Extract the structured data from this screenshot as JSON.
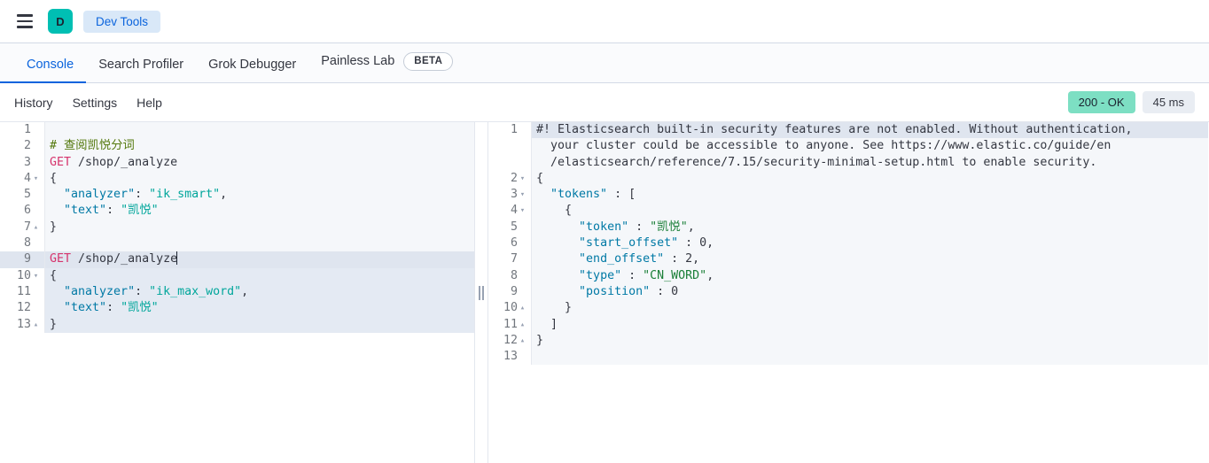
{
  "chrome": {
    "menu_icon": "hamburger-menu-icon",
    "space_avatar_letter": "D",
    "space_avatar_color": "#00BFB3",
    "breadcrumb_label": "Dev Tools"
  },
  "tabs": [
    {
      "label": "Console",
      "active": true
    },
    {
      "label": "Search Profiler",
      "active": false
    },
    {
      "label": "Grok Debugger",
      "active": false
    },
    {
      "label": "Painless Lab",
      "active": false,
      "badge": "BETA"
    }
  ],
  "console_toolbar": {
    "links": [
      "History",
      "Settings",
      "Help"
    ],
    "status_text": "200 - OK",
    "status_color": "#7DDFC3",
    "time_text": "45 ms",
    "time_color": "#E9EDF3"
  },
  "request_editor": {
    "play_icon": "play-triangle-icon",
    "wrench_icon": "wrench-icon",
    "lines": [
      {
        "n": "1",
        "fold": "",
        "tokens": []
      },
      {
        "n": "2",
        "fold": "",
        "tokens": [
          {
            "t": "# 查阅凯悦分词",
            "c": "c-comment"
          }
        ]
      },
      {
        "n": "3",
        "fold": "",
        "tokens": [
          {
            "t": "GET",
            "c": "c-method"
          },
          {
            "t": " /shop/_analyze",
            "c": "c-url"
          }
        ]
      },
      {
        "n": "4",
        "fold": "▾",
        "tokens": [
          {
            "t": "{",
            "c": "c-punc"
          }
        ]
      },
      {
        "n": "5",
        "fold": "",
        "tokens": [
          {
            "t": "  ",
            "c": "c-plain"
          },
          {
            "t": "\"analyzer\"",
            "c": "c-key"
          },
          {
            "t": ": ",
            "c": "c-punc"
          },
          {
            "t": "\"ik_smart\"",
            "c": "c-string"
          },
          {
            "t": ",",
            "c": "c-punc"
          }
        ]
      },
      {
        "n": "6",
        "fold": "",
        "tokens": [
          {
            "t": "  ",
            "c": "c-plain"
          },
          {
            "t": "\"text\"",
            "c": "c-key"
          },
          {
            "t": ": ",
            "c": "c-punc"
          },
          {
            "t": "\"凯悦\"",
            "c": "c-string"
          }
        ]
      },
      {
        "n": "7",
        "fold": "▴",
        "tokens": [
          {
            "t": "}",
            "c": "c-punc"
          }
        ]
      },
      {
        "n": "8",
        "fold": "",
        "tokens": []
      },
      {
        "n": "9",
        "fold": "",
        "active": true,
        "caret": true,
        "tokens": [
          {
            "t": "GET",
            "c": "c-method"
          },
          {
            "t": " /shop/_analyze",
            "c": "c-url"
          }
        ]
      },
      {
        "n": "10",
        "fold": "▾",
        "block": true,
        "tokens": [
          {
            "t": "{",
            "c": "c-punc"
          }
        ]
      },
      {
        "n": "11",
        "fold": "",
        "block": true,
        "tokens": [
          {
            "t": "  ",
            "c": "c-plain"
          },
          {
            "t": "\"analyzer\"",
            "c": "c-key"
          },
          {
            "t": ": ",
            "c": "c-punc"
          },
          {
            "t": "\"ik_max_word\"",
            "c": "c-string"
          },
          {
            "t": ",",
            "c": "c-punc"
          }
        ]
      },
      {
        "n": "12",
        "fold": "",
        "block": true,
        "tokens": [
          {
            "t": "  ",
            "c": "c-plain"
          },
          {
            "t": "\"text\"",
            "c": "c-key"
          },
          {
            "t": ": ",
            "c": "c-punc"
          },
          {
            "t": "\"凯悦\"",
            "c": "c-string"
          }
        ]
      },
      {
        "n": "13",
        "fold": "▴",
        "block": true,
        "tokens": [
          {
            "t": "}",
            "c": "c-punc"
          }
        ]
      }
    ]
  },
  "response_editor": {
    "error_marker": "error-x-icon",
    "lines": [
      {
        "n": "1",
        "fold": "",
        "warn": true,
        "tokens": [
          {
            "t": "#! Elasticsearch built-in security features are not enabled. Without authentication,",
            "c": "c-plain"
          }
        ]
      },
      {
        "n": "",
        "fold": "",
        "tokens": [
          {
            "t": "  your cluster could be accessible to anyone. See https://www.elastic.co/guide/en",
            "c": "c-plain"
          }
        ]
      },
      {
        "n": "",
        "fold": "",
        "tokens": [
          {
            "t": "  /elasticsearch/reference/7.15/security-minimal-setup.html to enable security.",
            "c": "c-plain"
          }
        ]
      },
      {
        "n": "2",
        "fold": "▾",
        "tokens": [
          {
            "t": "{",
            "c": "c-punc"
          }
        ]
      },
      {
        "n": "3",
        "fold": "▾",
        "tokens": [
          {
            "t": "  ",
            "c": "c-plain"
          },
          {
            "t": "\"tokens\"",
            "c": "c-key"
          },
          {
            "t": " : [",
            "c": "c-punc"
          }
        ]
      },
      {
        "n": "4",
        "fold": "▾",
        "tokens": [
          {
            "t": "    {",
            "c": "c-punc"
          }
        ]
      },
      {
        "n": "5",
        "fold": "",
        "tokens": [
          {
            "t": "      ",
            "c": "c-plain"
          },
          {
            "t": "\"token\"",
            "c": "c-key"
          },
          {
            "t": " : ",
            "c": "c-punc"
          },
          {
            "t": "\"凯悦\"",
            "c": "c-strjson"
          },
          {
            "t": ",",
            "c": "c-punc"
          }
        ]
      },
      {
        "n": "6",
        "fold": "",
        "tokens": [
          {
            "t": "      ",
            "c": "c-plain"
          },
          {
            "t": "\"start_offset\"",
            "c": "c-key"
          },
          {
            "t": " : ",
            "c": "c-punc"
          },
          {
            "t": "0",
            "c": "c-num"
          },
          {
            "t": ",",
            "c": "c-punc"
          }
        ]
      },
      {
        "n": "7",
        "fold": "",
        "tokens": [
          {
            "t": "      ",
            "c": "c-plain"
          },
          {
            "t": "\"end_offset\"",
            "c": "c-key"
          },
          {
            "t": " : ",
            "c": "c-punc"
          },
          {
            "t": "2",
            "c": "c-num"
          },
          {
            "t": ",",
            "c": "c-punc"
          }
        ]
      },
      {
        "n": "8",
        "fold": "",
        "tokens": [
          {
            "t": "      ",
            "c": "c-plain"
          },
          {
            "t": "\"type\"",
            "c": "c-key"
          },
          {
            "t": " : ",
            "c": "c-punc"
          },
          {
            "t": "\"CN_WORD\"",
            "c": "c-strjson"
          },
          {
            "t": ",",
            "c": "c-punc"
          }
        ]
      },
      {
        "n": "9",
        "fold": "",
        "tokens": [
          {
            "t": "      ",
            "c": "c-plain"
          },
          {
            "t": "\"position\"",
            "c": "c-key"
          },
          {
            "t": " : ",
            "c": "c-punc"
          },
          {
            "t": "0",
            "c": "c-num"
          }
        ]
      },
      {
        "n": "10",
        "fold": "▴",
        "tokens": [
          {
            "t": "    }",
            "c": "c-punc"
          }
        ]
      },
      {
        "n": "11",
        "fold": "▴",
        "tokens": [
          {
            "t": "  ]",
            "c": "c-punc"
          }
        ]
      },
      {
        "n": "12",
        "fold": "▴",
        "tokens": [
          {
            "t": "}",
            "c": "c-punc"
          }
        ]
      },
      {
        "n": "13",
        "fold": "",
        "tokens": []
      }
    ]
  }
}
